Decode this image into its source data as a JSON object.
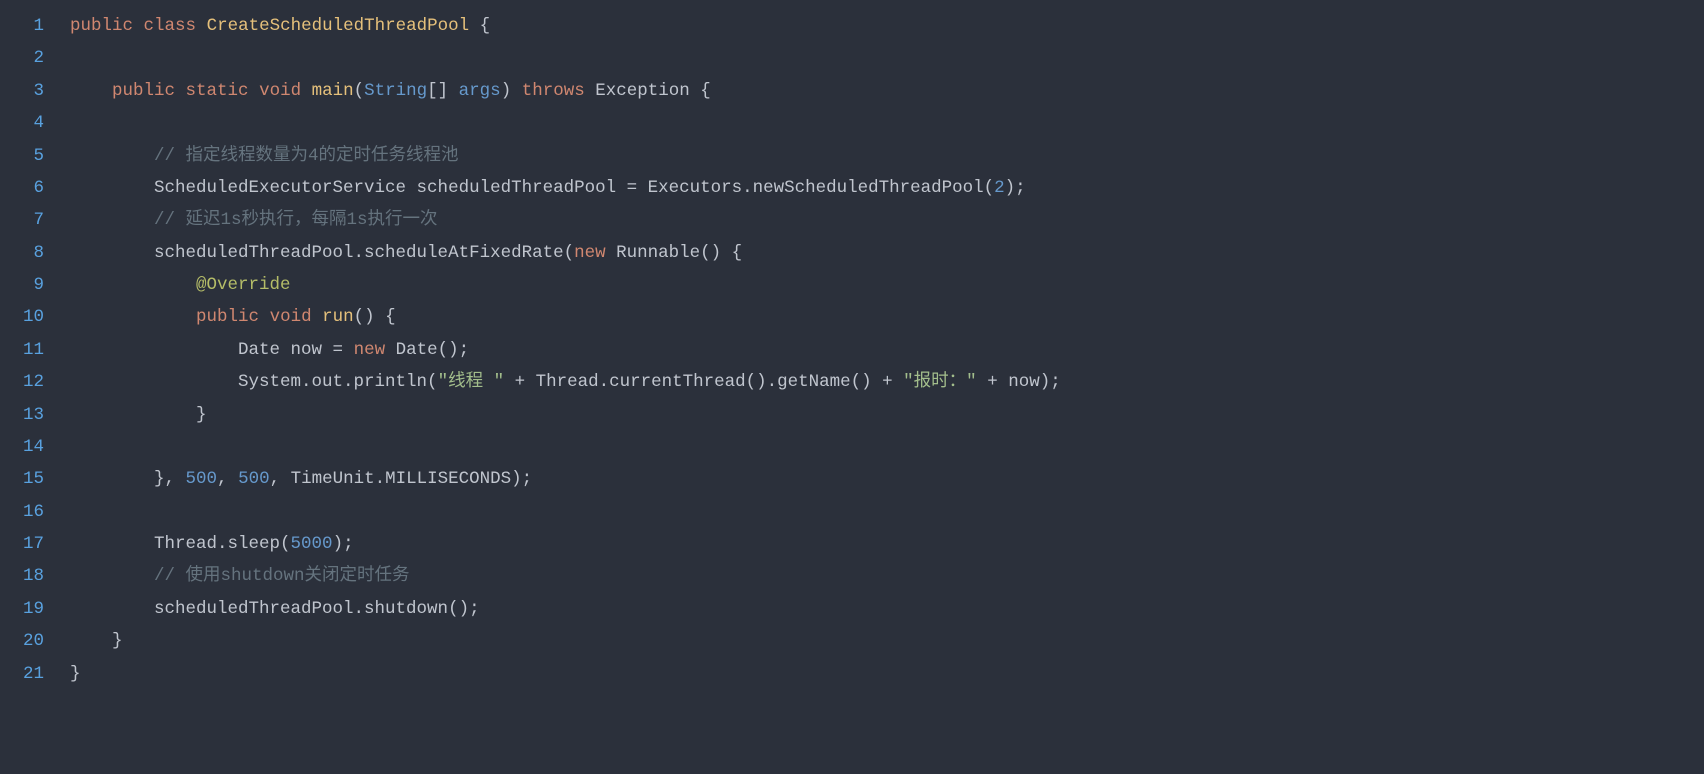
{
  "lineCount": 21,
  "lines": [
    [
      {
        "t": "public",
        "c": "kw"
      },
      {
        "t": " ",
        "c": "punct"
      },
      {
        "t": "class",
        "c": "kw"
      },
      {
        "t": " ",
        "c": "punct"
      },
      {
        "t": "CreateScheduledThreadPool",
        "c": "method"
      },
      {
        "t": " {",
        "c": "punct"
      }
    ],
    [],
    [
      {
        "t": "    ",
        "c": "punct"
      },
      {
        "t": "public",
        "c": "kw"
      },
      {
        "t": " ",
        "c": "punct"
      },
      {
        "t": "static",
        "c": "kw"
      },
      {
        "t": " ",
        "c": "punct"
      },
      {
        "t": "void",
        "c": "kw"
      },
      {
        "t": " ",
        "c": "punct"
      },
      {
        "t": "main",
        "c": "method"
      },
      {
        "t": "(",
        "c": "paren"
      },
      {
        "t": "String",
        "c": "param"
      },
      {
        "t": "[] ",
        "c": "punct"
      },
      {
        "t": "args",
        "c": "param"
      },
      {
        "t": ")",
        "c": "paren"
      },
      {
        "t": " ",
        "c": "punct"
      },
      {
        "t": "throws",
        "c": "kw"
      },
      {
        "t": " ",
        "c": "punct"
      },
      {
        "t": "Exception",
        "c": "ident"
      },
      {
        "t": " {",
        "c": "punct"
      }
    ],
    [],
    [
      {
        "t": "        ",
        "c": "punct"
      },
      {
        "t": "// 指定线程数量为4的定时任务线程池",
        "c": "comment"
      }
    ],
    [
      {
        "t": "        ",
        "c": "punct"
      },
      {
        "t": "ScheduledExecutorService scheduledThreadPool = Executors.newScheduledThreadPool(",
        "c": "ident"
      },
      {
        "t": "2",
        "c": "num"
      },
      {
        "t": ");",
        "c": "punct"
      }
    ],
    [
      {
        "t": "        ",
        "c": "punct"
      },
      {
        "t": "// 延迟1s秒执行，每隔1s执行一次",
        "c": "comment"
      }
    ],
    [
      {
        "t": "        ",
        "c": "punct"
      },
      {
        "t": "scheduledThreadPool.scheduleAtFixedRate(",
        "c": "ident"
      },
      {
        "t": "new",
        "c": "kw"
      },
      {
        "t": " ",
        "c": "punct"
      },
      {
        "t": "Runnable",
        "c": "ident"
      },
      {
        "t": "() {",
        "c": "punct"
      }
    ],
    [
      {
        "t": "            ",
        "c": "punct"
      },
      {
        "t": "@Override",
        "c": "ann"
      }
    ],
    [
      {
        "t": "            ",
        "c": "punct"
      },
      {
        "t": "public",
        "c": "kw"
      },
      {
        "t": " ",
        "c": "punct"
      },
      {
        "t": "void",
        "c": "kw"
      },
      {
        "t": " ",
        "c": "punct"
      },
      {
        "t": "run",
        "c": "method"
      },
      {
        "t": "() {",
        "c": "punct"
      }
    ],
    [
      {
        "t": "                ",
        "c": "punct"
      },
      {
        "t": "Date now = ",
        "c": "ident"
      },
      {
        "t": "new",
        "c": "kw"
      },
      {
        "t": " ",
        "c": "punct"
      },
      {
        "t": "Date",
        "c": "ident"
      },
      {
        "t": "();",
        "c": "punct"
      }
    ],
    [
      {
        "t": "                ",
        "c": "punct"
      },
      {
        "t": "System.out.println(",
        "c": "ident"
      },
      {
        "t": "\"线程 \"",
        "c": "str"
      },
      {
        "t": " + Thread.currentThread().getName() + ",
        "c": "ident"
      },
      {
        "t": "\"报时：\"",
        "c": "str"
      },
      {
        "t": " + now);",
        "c": "ident"
      }
    ],
    [
      {
        "t": "            }",
        "c": "punct"
      }
    ],
    [],
    [
      {
        "t": "        }, ",
        "c": "punct"
      },
      {
        "t": "500",
        "c": "num"
      },
      {
        "t": ", ",
        "c": "punct"
      },
      {
        "t": "500",
        "c": "num"
      },
      {
        "t": ", TimeUnit.MILLISECONDS);",
        "c": "ident"
      }
    ],
    [],
    [
      {
        "t": "        ",
        "c": "punct"
      },
      {
        "t": "Thread.sleep(",
        "c": "ident"
      },
      {
        "t": "5000",
        "c": "num"
      },
      {
        "t": ");",
        "c": "punct"
      }
    ],
    [
      {
        "t": "        ",
        "c": "punct"
      },
      {
        "t": "// 使用shutdown关闭定时任务",
        "c": "comment"
      }
    ],
    [
      {
        "t": "        ",
        "c": "punct"
      },
      {
        "t": "scheduledThreadPool.shutdown();",
        "c": "ident"
      }
    ],
    [
      {
        "t": "    }",
        "c": "punct"
      }
    ],
    [
      {
        "t": "}",
        "c": "punct"
      }
    ]
  ]
}
